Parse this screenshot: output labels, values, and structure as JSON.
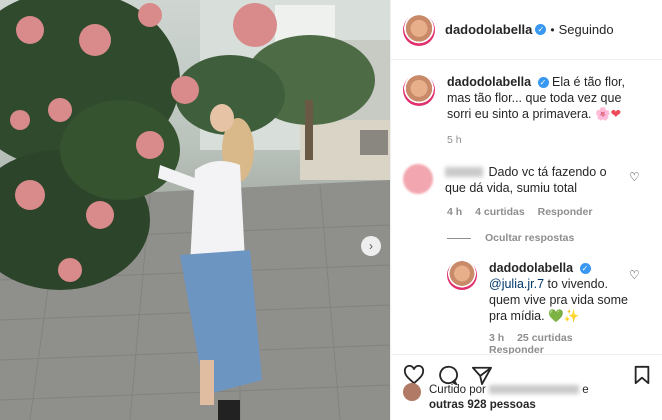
{
  "post": {
    "username": "dadodolabella",
    "follow_status": "Seguindo",
    "separator": "•"
  },
  "caption": {
    "username": "dadodolabella",
    "text": "Ela é tão flor, mas tão flor... que toda vez que sorri eu sinto a primavera.",
    "emoji": "🌸❤",
    "time": "5 h"
  },
  "comments": [
    {
      "text": "Dado vc tá fazendo o que dá vida, sumiu total",
      "time": "4 h",
      "likes": "4 curtidas",
      "reply": "Responder",
      "hide_replies": "Ocultar respostas"
    },
    {
      "username": "dadodolabella",
      "mention": "@julia.jr.7",
      "text": " to vivendo. quem vive pra vida some pra mídia.",
      "emoji": "💚✨",
      "time": "3 h",
      "likes": "25 curtidas",
      "reply": "Responder"
    }
  ],
  "liked_by": {
    "prefix": "Curtido por",
    "suffix": "e",
    "others": "outras 928 pessoas"
  },
  "colors": {
    "verified": "#3897f0",
    "heart": "#ed4956",
    "accent": "#00376b"
  },
  "icons": [
    "verified-icon",
    "heart-icon",
    "comment-icon",
    "share-icon",
    "bookmark-icon",
    "chevron-right-icon"
  ]
}
